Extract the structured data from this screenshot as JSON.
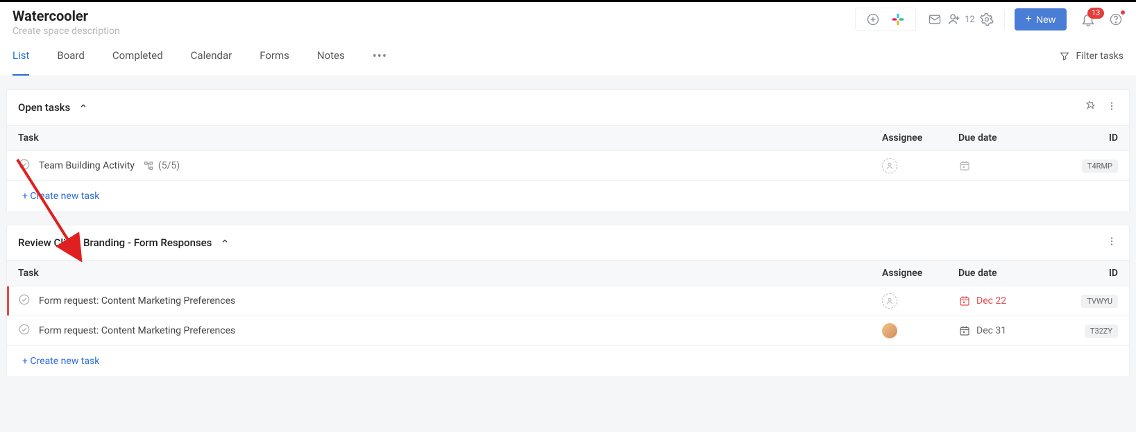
{
  "header": {
    "title": "Watercooler",
    "desc_placeholder": "Create space description",
    "members_count": "12",
    "new_button": "New",
    "notification_count": "13"
  },
  "tabs": {
    "items": [
      "List",
      "Board",
      "Completed",
      "Calendar",
      "Forms",
      "Notes"
    ],
    "active_index": 0,
    "filter_label": "Filter tasks"
  },
  "columns": {
    "task": "Task",
    "assignee": "Assignee",
    "due": "Due date",
    "id": "ID"
  },
  "sections": [
    {
      "title": "Open tasks",
      "show_pin": true,
      "tasks": [
        {
          "title": "Team Building Activity",
          "subtasks": "(5/5)",
          "assignee": "placeholder",
          "due": "",
          "due_state": "placeholder",
          "id": "T4RMP",
          "overdue": false
        }
      ],
      "create_label": "+ Create new task"
    },
    {
      "title": "Review Client Branding - Form Responses",
      "show_pin": false,
      "tasks": [
        {
          "title": "Form request: Content Marketing Preferences",
          "subtasks": "",
          "assignee": "placeholder",
          "due": "Dec 22",
          "due_state": "red",
          "id": "TVWYU",
          "overdue": true
        },
        {
          "title": "Form request: Content Marketing Preferences",
          "subtasks": "",
          "assignee": "avatar",
          "due": "Dec 31",
          "due_state": "gray",
          "id": "T32ZY",
          "overdue": false
        }
      ],
      "create_label": "+ Create new task"
    }
  ]
}
